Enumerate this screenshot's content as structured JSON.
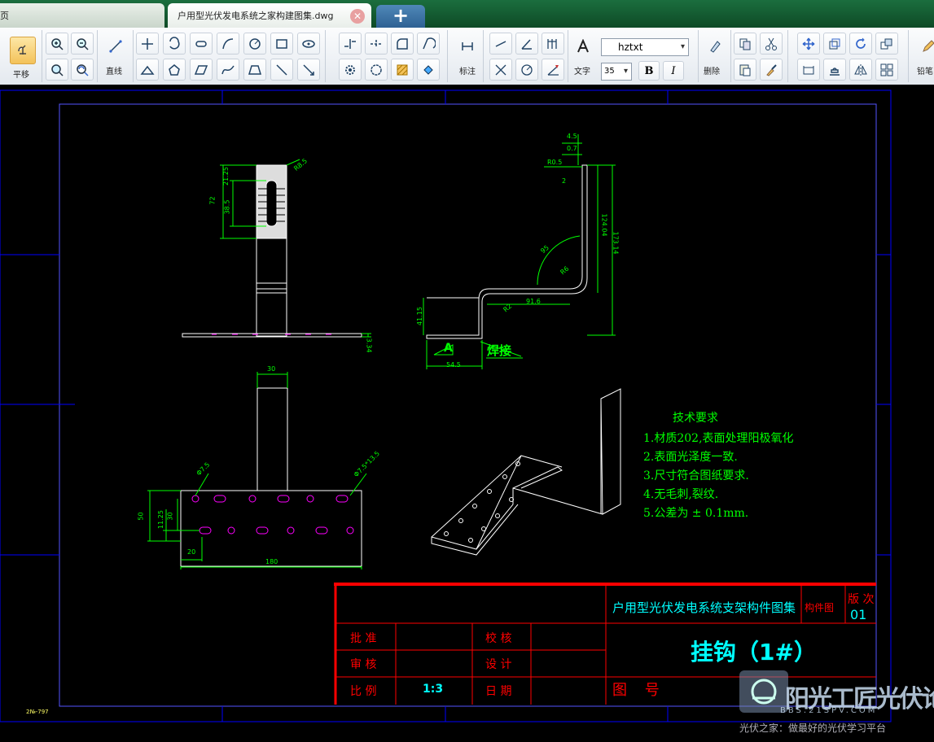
{
  "tabs": {
    "home_label": "页",
    "drawing_label": "户用型光伏发电系统之家构建图集.dwg",
    "add_glyph": "+",
    "close_glyph": "✕"
  },
  "ribbon": {
    "pan_label": "平移",
    "line_label": "直线",
    "dimension_label": "标注",
    "text_label": "文字",
    "font_value": "hztxt",
    "size_value": "35",
    "bold_label": "B",
    "italic_label": "I",
    "delete_label": "删除",
    "pencil_label": "铅笔"
  },
  "drawing": {
    "dims_top": [
      "4.5",
      "0.7",
      "R0.5",
      "2",
      "124.04",
      "173.14",
      "95",
      "R6",
      "91.6",
      "R2",
      "41.15",
      "54.5",
      "3.34"
    ],
    "dims_front": [
      "21.25",
      "38.5",
      "72",
      "R8.5"
    ],
    "dims_plan": [
      "30",
      "Φ7.5",
      "Φ7.5*13.5",
      "50",
      "11.25",
      "30",
      "20",
      "180"
    ],
    "weld_label": "焊接",
    "section_label": "A",
    "tech_title": "技术要求",
    "tech_items": [
      "1.材质202,表面处理阳极氧化",
      "2.表面光泽度一致.",
      "3.尺寸符合图纸要求.",
      "4.无毛刺,裂纹.",
      "5.公差为 ± 0.1mm."
    ],
    "coord_readout": "2№-797"
  },
  "title_block": {
    "project_title": "户用型光伏发电系统支架构件图集",
    "category": "构件图",
    "version_label": "版 次",
    "version_value": "01",
    "part_name": "挂钩（1#）",
    "approve_label": "批 准",
    "review_label": "审 核",
    "scale_label": "比 例",
    "scale_value": "1:3",
    "check_label": "校 核",
    "design_label": "设 计",
    "date_label": "日 期",
    "drawing_no_label": "图 号"
  },
  "watermark": {
    "brand": "阳光工匠光伏论坛",
    "url": "BBS.21SPV.COM",
    "tagline": "光伏之家：做最好的光伏学习平台"
  },
  "colors": {
    "ribbon_bg": "#e8edf2",
    "tab_green": "#0e4a26",
    "cad_white": "#ffffff",
    "cad_green": "#00ff00",
    "cad_cyan": "#00ffff",
    "cad_red": "#ff0000",
    "cad_blue": "#0000ff",
    "cad_magenta": "#ff00ff"
  },
  "icons": [
    "pan-icon",
    "zoom-in-icon",
    "zoom-out-icon",
    "zoom-window-icon",
    "zoom-realtime-icon",
    "line-icon",
    "move-icon",
    "copy-icon",
    "font-icon",
    "pencil-icon",
    "mirror-icon"
  ]
}
